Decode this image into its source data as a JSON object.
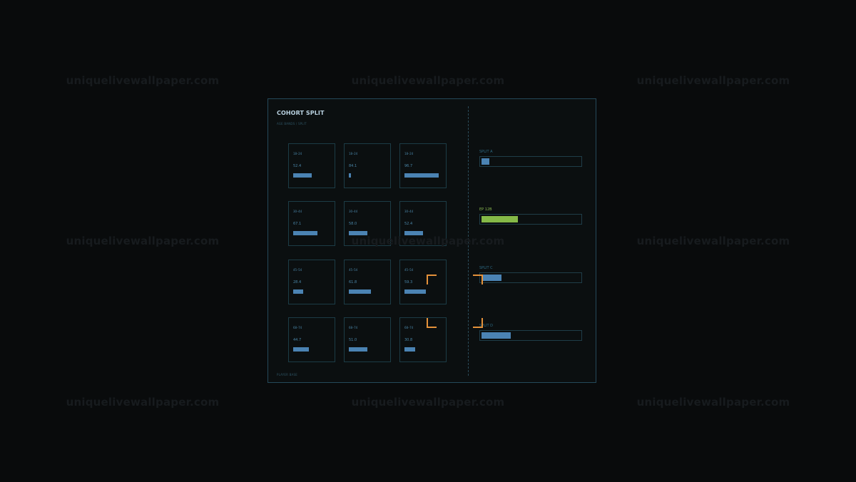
{
  "watermark": {
    "text": "uniquelivewallpaper.com"
  },
  "panel": {
    "title": "COHORT SPLIT",
    "subtitle": "AGE BANDS / SPLIT",
    "footer": "PLAYER BASE"
  },
  "grid": {
    "cells": [
      {
        "label": "18–24",
        "value": "52.4",
        "level": 0.524
      },
      {
        "label": "18–24",
        "value": "84.1",
        "level": 0.05
      },
      {
        "label": "18–24",
        "value": "96.7",
        "level": 0.967
      },
      {
        "label": "30–44",
        "value": "67.1",
        "level": 0.671
      },
      {
        "label": "30–44",
        "value": "58.0",
        "level": 0.52
      },
      {
        "label": "30–44",
        "value": "52.4",
        "level": 0.524
      },
      {
        "label": "45–54",
        "value": "28.4",
        "level": 0.284
      },
      {
        "label": "45–54",
        "value": "61.8",
        "level": 0.618
      },
      {
        "label": "45–54",
        "value": "59.3",
        "level": 0.593
      },
      {
        "label": "68–74",
        "value": "44.7",
        "level": 0.447
      },
      {
        "label": "68–74",
        "value": "51.0",
        "level": 0.51
      },
      {
        "label": "68–74",
        "value": "30.8",
        "level": 0.308
      }
    ]
  },
  "splits": [
    {
      "label": "SPLIT A",
      "level": 0.08,
      "active": false
    },
    {
      "label": "EP 12B",
      "level": 0.37,
      "active": true
    },
    {
      "label": "SPLIT C",
      "level": 0.2,
      "active": false
    },
    {
      "label": "SPLIT D",
      "level": 0.3,
      "active": false
    }
  ],
  "colors": {
    "accent_blue": "#4b83b3",
    "accent_green": "#85b947",
    "focus_orange": "#e4913a",
    "border": "#25495a"
  },
  "icons": {
    "focus": "corner-bracket-icon"
  }
}
